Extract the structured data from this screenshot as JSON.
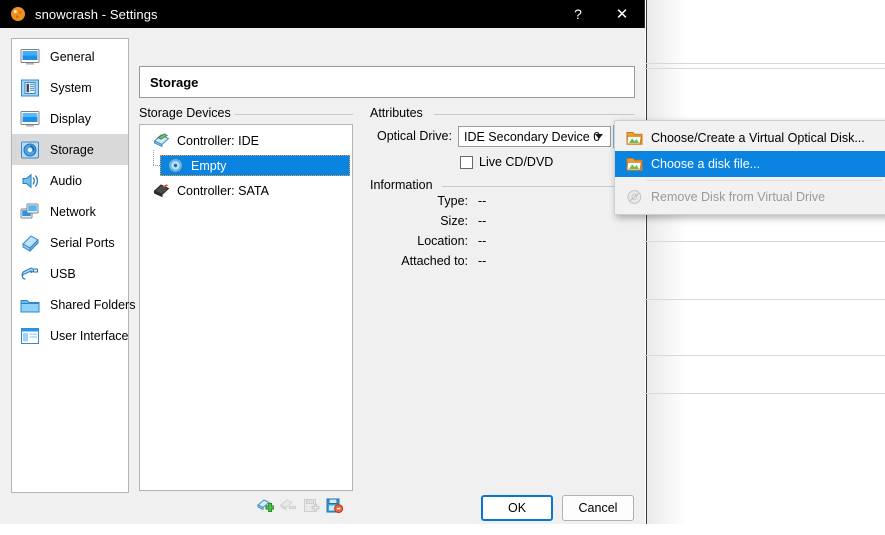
{
  "window": {
    "title": "snowcrash - Settings",
    "app_icon": "virtualbox-icon",
    "help_button": "?",
    "close_button": "✕"
  },
  "sidebar": {
    "items": [
      {
        "label": "General",
        "icon": "monitor-icon",
        "selected": false
      },
      {
        "label": "System",
        "icon": "motherboard-icon",
        "selected": false
      },
      {
        "label": "Display",
        "icon": "display-icon",
        "selected": false
      },
      {
        "label": "Storage",
        "icon": "harddisk-icon",
        "selected": true
      },
      {
        "label": "Audio",
        "icon": "speaker-icon",
        "selected": false
      },
      {
        "label": "Network",
        "icon": "network-icon",
        "selected": false
      },
      {
        "label": "Serial Ports",
        "icon": "serial-port-icon",
        "selected": false
      },
      {
        "label": "USB",
        "icon": "usb-icon",
        "selected": false
      },
      {
        "label": "Shared Folders",
        "icon": "folder-icon",
        "selected": false
      },
      {
        "label": "User Interface",
        "icon": "user-interface-icon",
        "selected": false
      }
    ]
  },
  "page": {
    "title": "Storage"
  },
  "storage_devices": {
    "group_title": "Storage Devices",
    "tree": [
      {
        "label": "Controller: IDE",
        "icon": "ide-controller-icon",
        "level": 0,
        "selected": false
      },
      {
        "label": "Empty",
        "icon": "optical-disk-icon",
        "level": 1,
        "selected": true
      },
      {
        "label": "Controller: SATA",
        "icon": "sata-controller-icon",
        "level": 0,
        "selected": false
      }
    ],
    "toolbar": [
      {
        "name": "add-controller-button",
        "icon": "add-controller-icon",
        "enabled": true
      },
      {
        "name": "remove-controller-button",
        "icon": "remove-controller-icon",
        "enabled": false
      },
      {
        "name": "add-attachment-button",
        "icon": "add-attachment-icon",
        "enabled": false
      },
      {
        "name": "remove-attachment-button",
        "icon": "remove-attachment-icon",
        "enabled": true
      }
    ]
  },
  "attributes": {
    "group_title": "Attributes",
    "optical_drive_label": "Optical Drive:",
    "optical_drive_value": "IDE Secondary Device 0",
    "disk_picker_icon": "optical-disk-icon",
    "live_cd_label": "Live CD/DVD",
    "live_cd_checked": false
  },
  "information": {
    "group_title": "Information",
    "rows": [
      {
        "label": "Type:",
        "value": "--"
      },
      {
        "label": "Size:",
        "value": "--"
      },
      {
        "label": "Location:",
        "value": "--"
      },
      {
        "label": "Attached to:",
        "value": "--"
      }
    ]
  },
  "buttons": {
    "ok": "OK",
    "cancel": "Cancel"
  },
  "context_menu": {
    "items": [
      {
        "label": "Choose/Create a Virtual Optical Disk...",
        "icon": "folder-open-icon",
        "highlight": false,
        "disabled": false
      },
      {
        "label": "Choose a disk file...",
        "icon": "folder-open-icon",
        "highlight": true,
        "disabled": false
      },
      {
        "label": "Remove Disk from Virtual Drive",
        "icon": "remove-disk-icon",
        "highlight": false,
        "disabled": true
      }
    ]
  },
  "colors": {
    "accent_blue": "#0a84e0",
    "titlebar_bg": "#000000",
    "dialog_bg": "#f0f0f0",
    "selection_blue": "#0a84e0",
    "focus_blue": "#0a76d4"
  }
}
